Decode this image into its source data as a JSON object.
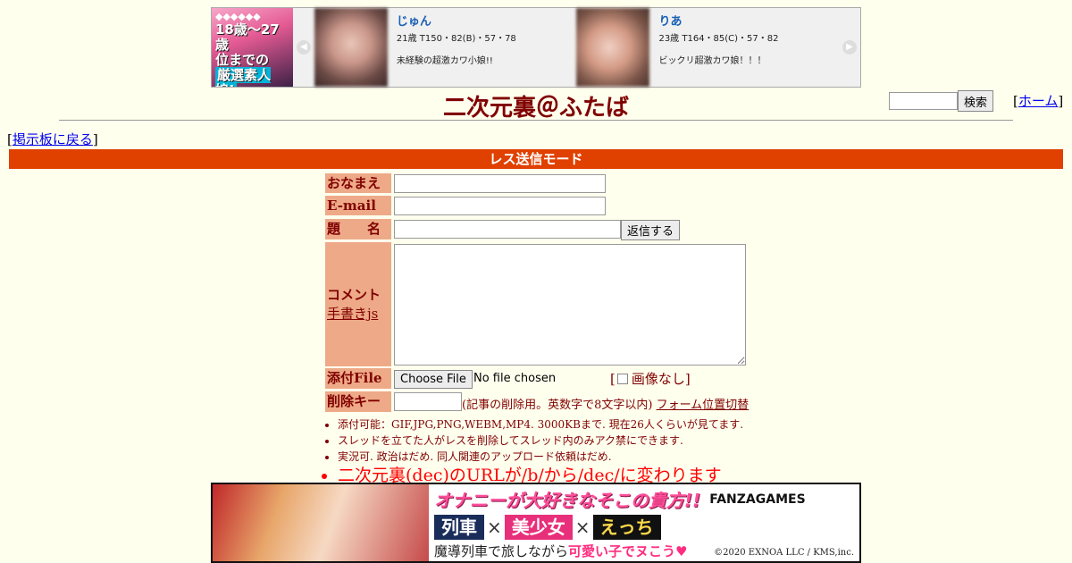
{
  "top_ad": {
    "banner_lines": [
      "◆◆◆◆◆◆",
      "18歳〜27歳",
      "位までの",
      "厳選素人娘!"
    ],
    "cards": [
      {
        "name": "じゅん",
        "stats": "21歳 T150・82(B)・57・78",
        "desc": "未経験の超激カワ小娘!!"
      },
      {
        "name": "りあ",
        "stats": "23歳 T164・85(C)・57・82",
        "desc": "ビックリ超激カワ娘！！！"
      }
    ]
  },
  "header": {
    "title": "二次元裏＠ふたば",
    "search_button": "検索",
    "home_link": "ホーム",
    "back_link": "掲示板に戻る"
  },
  "mode_bar": "レス送信モード",
  "form": {
    "name_label": "おなまえ",
    "email_label": "E-mail",
    "subject_label": "題　　名",
    "reply_button": "返信する",
    "comment_label": "コメント",
    "handwrite_link": "手書きjs",
    "file_label": "添付File",
    "file_button": "Choose File",
    "file_status": "No file chosen",
    "no_image": "画像なし",
    "delkey_label": "削除キー",
    "delkey_note": "(記事の削除用。英数字で8文字以内)",
    "form_position_link": "フォーム位置切替"
  },
  "rules": [
    "添付可能：GIF,JPG,PNG,WEBM,MP4. 3000KBまで. 現在26人くらいが見てます.",
    "スレッドを立てた人がレスを削除してスレッド内のみアク禁にできます.",
    "実況可. 政治はだめ. 同人関連のアップロード依頼はだめ."
  ],
  "notice": "二次元裏(dec)のURLが/b/から/dec/に変わります",
  "bottom_ad": {
    "headline": "オナニーが大好きなそこの貴方!!",
    "tags": [
      "列車",
      "美少女",
      "えっち"
    ],
    "brand": "FANZAGAMES",
    "tagline_plain": "魔導列車で旅しながら",
    "tagline_emph": "可愛い子でヌこう♥",
    "copyright": "©2020 EXNOA LLC / KMS,inc."
  }
}
